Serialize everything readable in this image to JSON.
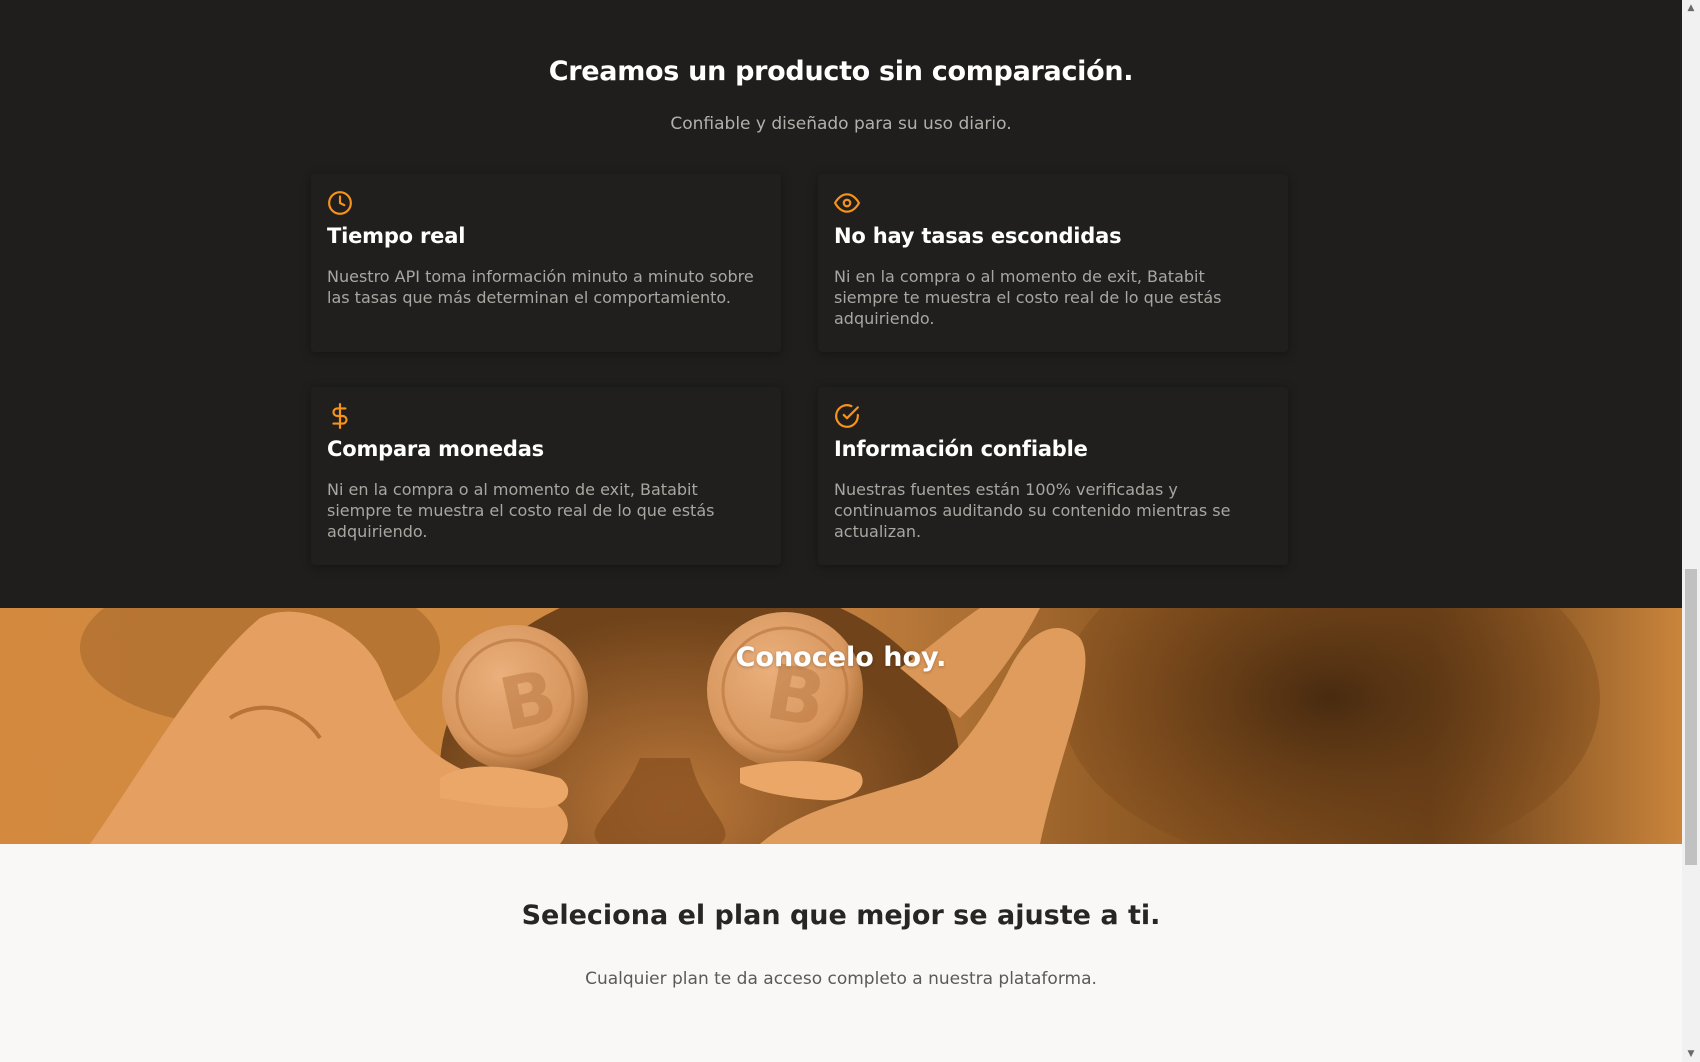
{
  "colors": {
    "accent": "#f7931a",
    "dark_bg": "#1f1e1d",
    "light_bg": "#f9f8f6",
    "hero_tint": "#d0883f"
  },
  "features": {
    "title": "Creamos un producto sin comparación.",
    "subtitle": "Confiable y diseñado para su uso diario.",
    "cards": [
      {
        "icon": "clock-icon",
        "title": "Tiempo real",
        "text": "Nuestro API toma información minuto a minuto sobre las tasas que más determinan el comportamiento."
      },
      {
        "icon": "eye-icon",
        "title": "No hay tasas escondidas",
        "text": "Ni en la compra o al momento de exit, Batabit siempre te muestra el costo real de lo que estás adquiriendo."
      },
      {
        "icon": "dollar-icon",
        "title": "Compara monedas",
        "text": "Ni en la compra o al momento de exit, Batabit siempre te muestra el costo real de lo que estás adquiriendo."
      },
      {
        "icon": "check-circle-icon",
        "title": "Información confiable",
        "text": "Nuestras fuentes están 100% verificadas y continuamos auditando su contenido mientras se actualizan."
      }
    ]
  },
  "hero": {
    "title": "Conocelo hoy."
  },
  "plans": {
    "title": "Seleciona el plan que mejor se ajuste a ti.",
    "subtitle": "Cualquier plan te da acceso completo a nuestra plataforma."
  }
}
